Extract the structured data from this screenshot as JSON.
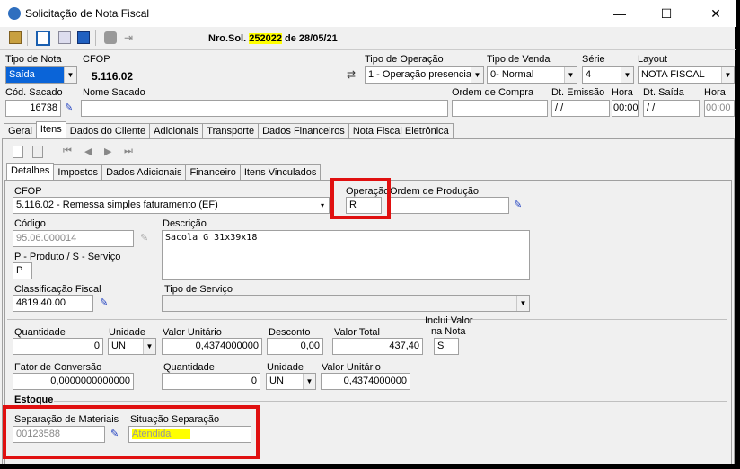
{
  "window": {
    "title": "Solicitação de Nota Fiscal",
    "min": "—",
    "max": "☐",
    "close": "✕"
  },
  "toolbar": {
    "nro_label": "Nro.Sol.",
    "nro_value": "252022",
    "date_text": "de 28/05/21"
  },
  "header": {
    "tipo_nota_label": "Tipo de Nota",
    "tipo_nota_value": "Saída",
    "cfop_label": "CFOP",
    "cfop_value": "5.116.02",
    "tipo_operacao_label": "Tipo de Operação",
    "tipo_operacao_value": "1 - Operação presencial",
    "tipo_venda_label": "Tipo de Venda",
    "tipo_venda_value": "0- Normal",
    "serie_label": "Série",
    "serie_value": "4",
    "layout_label": "Layout",
    "layout_value": "NOTA FISCAL",
    "cod_sacado_label": "Cód. Sacado",
    "cod_sacado_value": "16738",
    "nome_sacado_label": "Nome Sacado",
    "nome_sacado_value": "",
    "ordem_compra_label": "Ordem de Compra",
    "ordem_compra_value": "",
    "dt_emissao_label": "Dt. Emissão",
    "dt_emissao_value": " / /",
    "hora1_label": "Hora",
    "hora1_value": "00:00",
    "dt_saida_label": "Dt. Saída",
    "dt_saida_value": " / /",
    "hora2_label": "Hora",
    "hora2_value": "00:00"
  },
  "main_tabs": [
    "Geral",
    "Itens",
    "Dados do Cliente",
    "Adicionais",
    "Transporte",
    "Dados Financeiros",
    "Nota Fiscal Eletrônica"
  ],
  "sub_tabs": [
    "Detalhes",
    "Impostos",
    "Dados Adicionais",
    "Financeiro",
    "Itens Vinculados"
  ],
  "item": {
    "cfop_label": "CFOP",
    "cfop_value": "5.116.02 - Remessa simples faturamento (EF)",
    "operacao_label": "Operação",
    "operacao_value": "R",
    "ordem_producao_label": "Ordem de Produção",
    "ordem_producao_value": "",
    "codigo_label": "Código",
    "codigo_value": "95.06.000014",
    "descricao_label": "Descrição",
    "descricao_value": "Sacola G 31x39x18",
    "ps_label": "P - Produto / S - Serviço",
    "ps_value": "P",
    "class_fiscal_label": "Classificação Fiscal",
    "class_fiscal_value": "4819.40.00",
    "tipo_servico_label": "Tipo de Serviço",
    "tipo_servico_value": "",
    "quantidade_label": "Quantidade",
    "quantidade_value": "0",
    "unidade_label": "Unidade",
    "unidade_value": "UN",
    "valor_unit_label": "Valor Unitário",
    "valor_unit_value": "0,4374000000",
    "desconto_label": "Desconto",
    "desconto_value": "0,00",
    "valor_total_label": "Valor Total",
    "valor_total_value": "437,40",
    "inclui_valor_label1": "Inclui Valor",
    "inclui_valor_label2": "na Nota",
    "inclui_valor_value": "S",
    "fator_label": "Fator de Conversão",
    "fator_value": "0,0000000000000",
    "quantidade2_label": "Quantidade",
    "quantidade2_value": "0",
    "unidade2_label": "Unidade",
    "unidade2_value": "UN",
    "valor_unit2_label": "Valor Unitário",
    "valor_unit2_value": "0,4374000000",
    "estoque_label": "Estoque",
    "sep_materiais_label": "Separação de Materiais",
    "sep_materiais_value": "00123588",
    "situacao_label": "Situação Separação",
    "situacao_value": "Atendida"
  }
}
